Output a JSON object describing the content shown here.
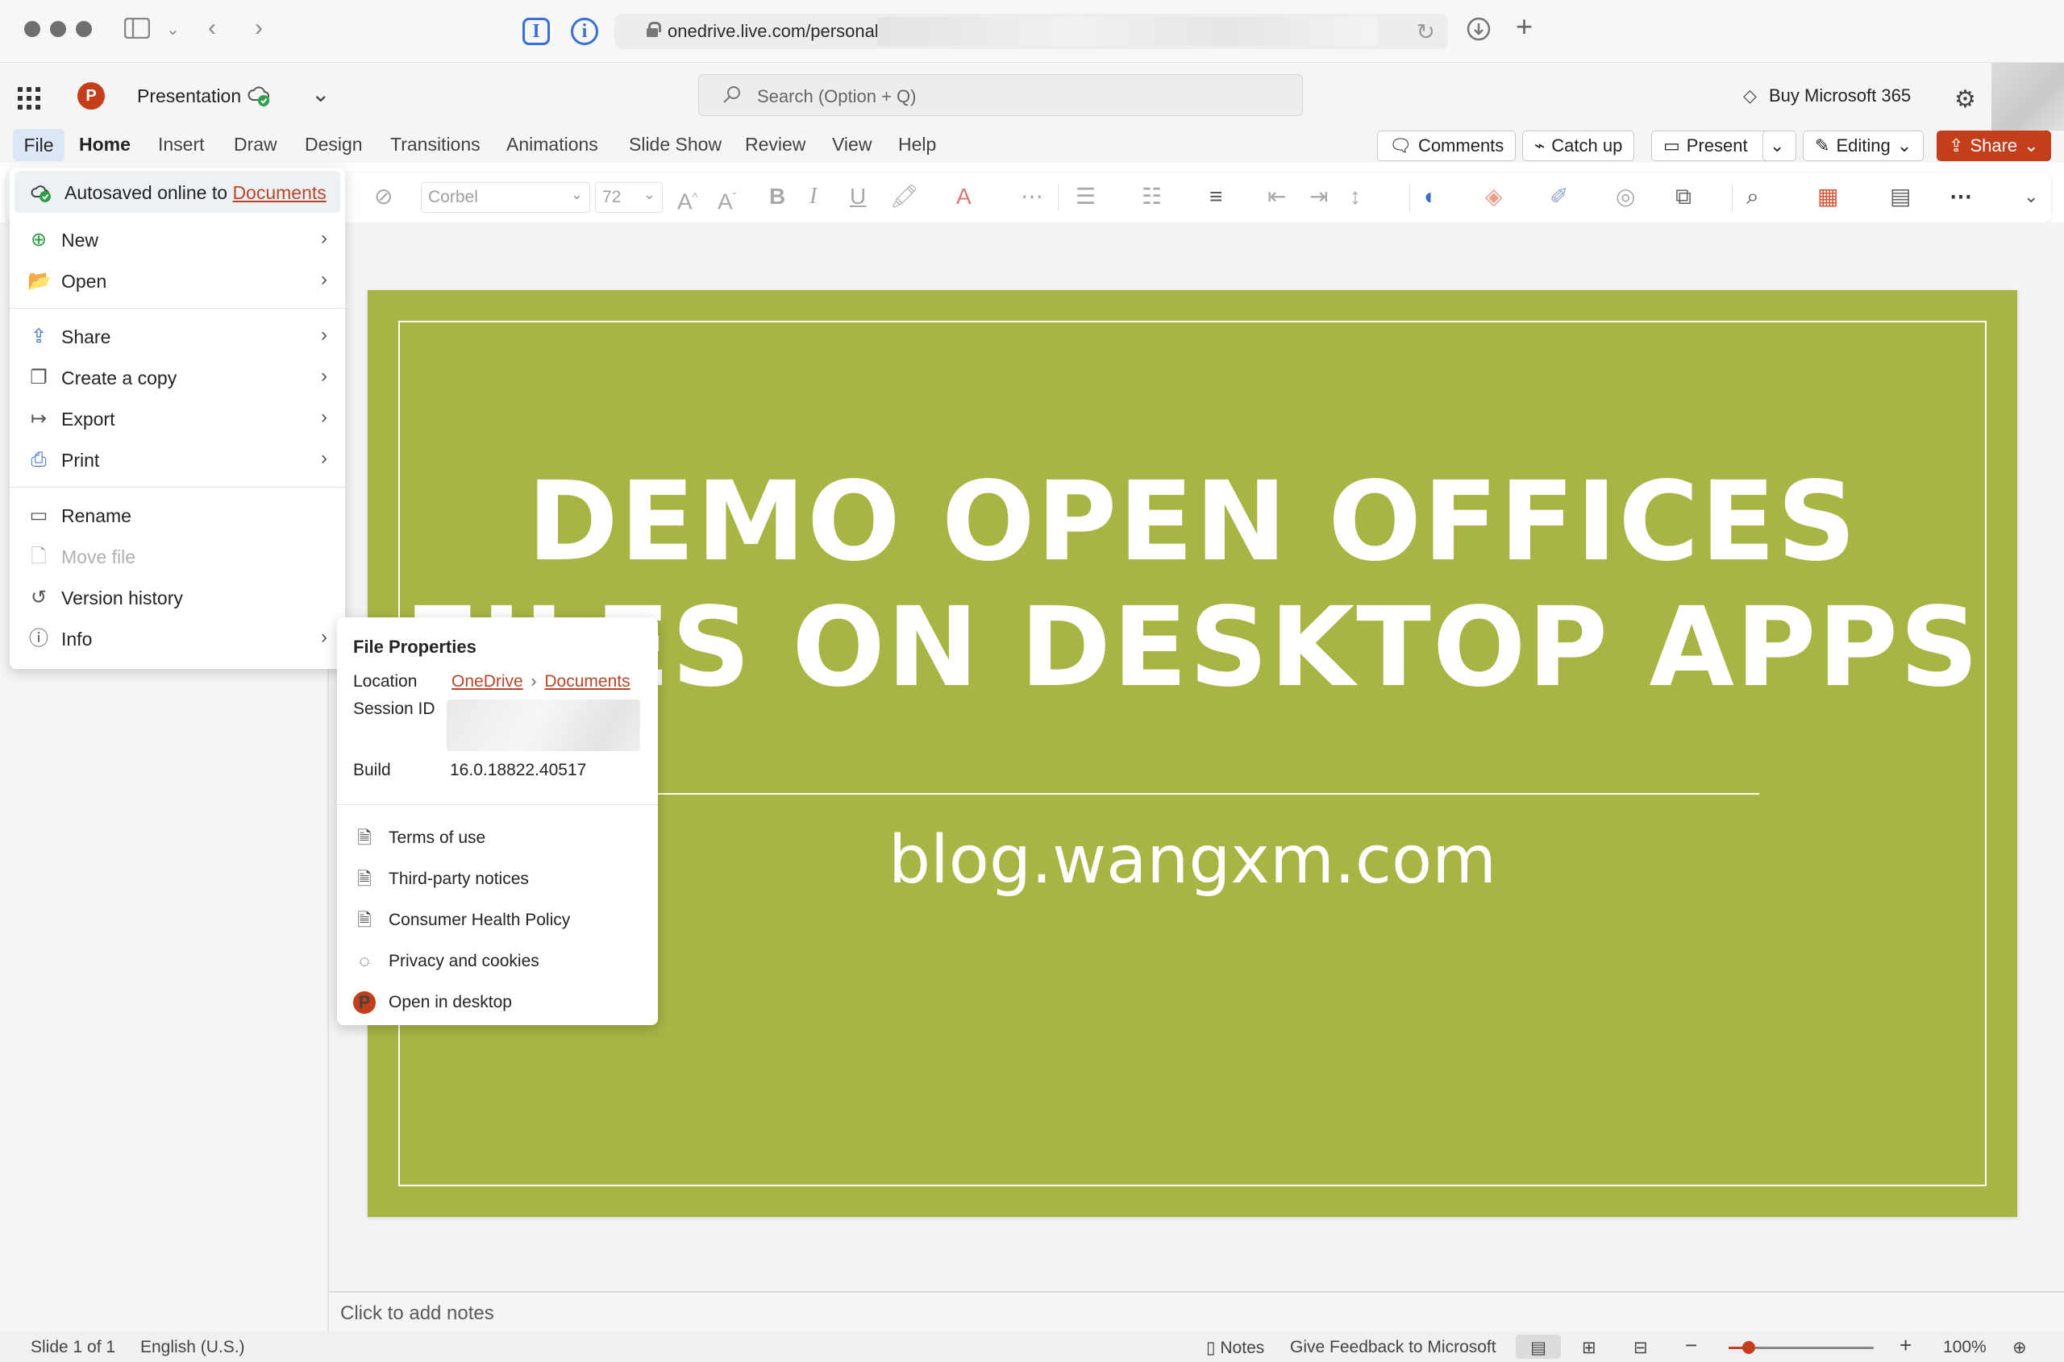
{
  "browser": {
    "url": "onedrive.live.com/personal"
  },
  "app": {
    "doc_title": "Presentation",
    "search_placeholder": "Search (Option + Q)",
    "buy_label": "Buy Microsoft 365"
  },
  "ribbon": {
    "tabs": [
      {
        "label": "File"
      },
      {
        "label": "Home"
      },
      {
        "label": "Insert"
      },
      {
        "label": "Draw"
      },
      {
        "label": "Design"
      },
      {
        "label": "Transitions"
      },
      {
        "label": "Animations"
      },
      {
        "label": "Slide Show"
      },
      {
        "label": "Review"
      },
      {
        "label": "View"
      },
      {
        "label": "Help"
      }
    ],
    "buttons": {
      "comments": "Comments",
      "catch_up": "Catch up",
      "present": "Present",
      "editing": "Editing",
      "share": "Share"
    }
  },
  "toolbar": {
    "font_name": "Corbel",
    "font_size": "72"
  },
  "file_menu": {
    "autosave_prefix": "Autosaved online to",
    "autosave_link": "Documents",
    "items": [
      {
        "label": "New"
      },
      {
        "label": "Open"
      },
      {
        "label": "Share"
      },
      {
        "label": "Create a copy"
      },
      {
        "label": "Export"
      },
      {
        "label": "Print"
      },
      {
        "label": "Rename"
      },
      {
        "label": "Move file"
      },
      {
        "label": "Version history"
      },
      {
        "label": "Info"
      }
    ]
  },
  "info_panel": {
    "title": "File Properties",
    "location_label": "Location",
    "location_root": "OneDrive",
    "location_folder": "Documents",
    "session_label": "Session ID",
    "build_label": "Build",
    "build_value": "16.0.18822.40517",
    "items": [
      {
        "label": "Terms of use"
      },
      {
        "label": "Third-party notices"
      },
      {
        "label": "Consumer Health Policy"
      },
      {
        "label": "Privacy and cookies"
      },
      {
        "label": "Open in desktop"
      }
    ]
  },
  "slide": {
    "title_line1": "DEMO OPEN OFFICES",
    "title_line2": "FILES ON DESKTOP APPS",
    "subtitle": "blog.wangxm.com",
    "bg_color": "#a8b545"
  },
  "notes": {
    "placeholder": "Click to add notes"
  },
  "status": {
    "slide_count": "Slide 1 of 1",
    "language": "English (U.S.)",
    "notes": "Notes",
    "feedback": "Give Feedback to Microsoft",
    "zoom": "100%",
    "zoom_level": 0.14
  },
  "colors": {
    "accent": "#c43e1c",
    "link": "#b7472a"
  }
}
